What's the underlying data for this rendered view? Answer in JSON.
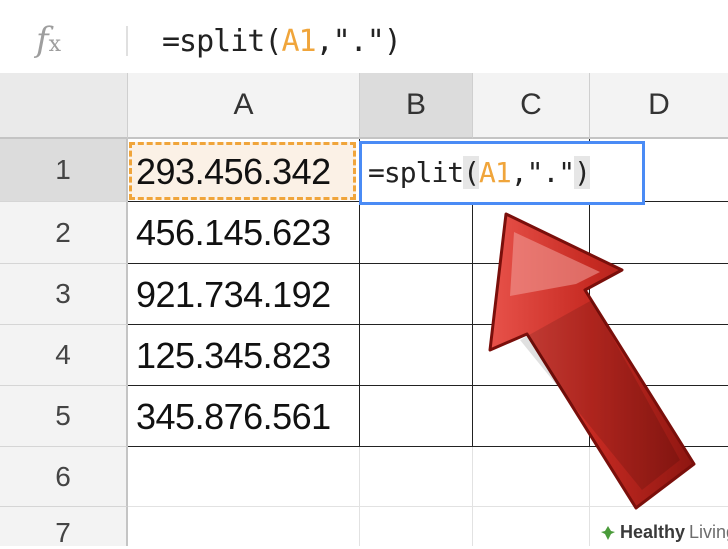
{
  "formula_bar": {
    "icon": "fx-icon",
    "formula_prefix": "=split(",
    "formula_ref": "A1",
    "formula_suffix": ",\".\")"
  },
  "columns": [
    "A",
    "B",
    "C",
    "D"
  ],
  "rows": [
    "1",
    "2",
    "3",
    "4",
    "5",
    "6",
    "7"
  ],
  "column_a_values": [
    "293.456.342",
    "456.145.623",
    "921.734.192",
    "125.345.823",
    "345.876.561"
  ],
  "active_cell": {
    "prefix": "=split",
    "open_paren": "(",
    "ref": "A1",
    "middle": ",\".\"",
    "close_paren": ")"
  },
  "watermark": {
    "bold": "Healthy",
    "light": "Living"
  },
  "colors": {
    "reference_orange": "#f0a53b",
    "active_blue": "#4a8bf5",
    "arrow_red": "#c0281f"
  }
}
